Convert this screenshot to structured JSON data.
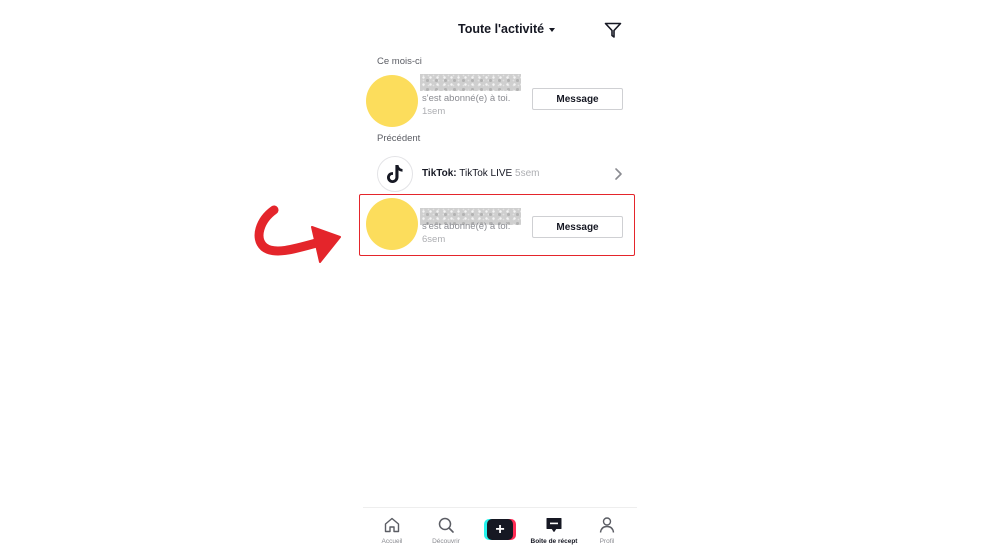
{
  "header": {
    "title": "Toute l'activité"
  },
  "sections": {
    "this_month": "Ce mois-ci",
    "previous": "Précédent"
  },
  "notifications": [
    {
      "text": "s'est abonné(e) à toi.",
      "time": "1sem",
      "button": "Message"
    },
    {
      "text": "s'est abonné(e) à toi.",
      "time": "6sem",
      "button": "Message"
    }
  ],
  "tiktok_live": {
    "sender": "TikTok:",
    "message": "TikTok LIVE",
    "time": "5sem"
  },
  "bottom_nav": [
    {
      "label": "Accueil"
    },
    {
      "label": "Découvrir"
    },
    {
      "label": "Boîte de récept"
    },
    {
      "label": "Profil"
    }
  ],
  "colors": {
    "avatar": "#fcdd5c",
    "highlight": "#e4252b",
    "text": "#161823"
  },
  "icons": [
    "filter-icon",
    "tiktok-logo-icon",
    "chevron-right-icon",
    "home-icon",
    "search-icon",
    "plus-icon",
    "inbox-icon",
    "profile-icon"
  ]
}
